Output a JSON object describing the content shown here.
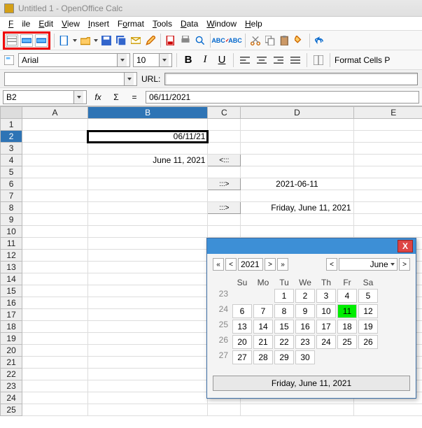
{
  "title": "Untitled 1 - OpenOffice Calc",
  "menu": {
    "file": "File",
    "edit": "Edit",
    "view": "View",
    "insert": "Insert",
    "format": "Format",
    "tools": "Tools",
    "data": "Data",
    "window": "Window",
    "help": "Help"
  },
  "format": {
    "font": "Arial",
    "size": "10",
    "cells": "Format Cells  P"
  },
  "url_label": "URL:",
  "cellref": "B2",
  "formula": "06/11/2021",
  "cols": [
    "A",
    "B",
    "C",
    "D",
    "E"
  ],
  "rows": [
    "1",
    "2",
    "3",
    "4",
    "5",
    "6",
    "7",
    "8",
    "9",
    "10",
    "11",
    "12",
    "13",
    "14",
    "15",
    "16",
    "17",
    "18",
    "19",
    "20",
    "21",
    "22",
    "23",
    "24",
    "25"
  ],
  "cells": {
    "B2": "06/11/21",
    "B4": "June 11, 2021",
    "D6": "2021-06-11",
    "D8": "Friday, June 11, 2021",
    "C4": "<:::",
    "C6": ":::>",
    "C8": ":::>"
  },
  "calendar": {
    "year": "2021",
    "month": "June",
    "nav": {
      "prevfar": "«",
      "prev": "<",
      "next": ">",
      "nextfar": "»"
    },
    "heads": [
      "Su",
      "Mo",
      "Tu",
      "We",
      "Th",
      "Fr",
      "Sa"
    ],
    "weeks": [
      {
        "wk": "23",
        "days": [
          "",
          "",
          "1",
          "2",
          "3",
          "4",
          "5"
        ]
      },
      {
        "wk": "24",
        "days": [
          "6",
          "7",
          "8",
          "9",
          "10",
          "11",
          "12"
        ]
      },
      {
        "wk": "25",
        "days": [
          "13",
          "14",
          "15",
          "16",
          "17",
          "18",
          "19"
        ]
      },
      {
        "wk": "26",
        "days": [
          "20",
          "21",
          "22",
          "23",
          "24",
          "25",
          "26"
        ]
      },
      {
        "wk": "27",
        "days": [
          "27",
          "28",
          "29",
          "30",
          "",
          "",
          ""
        ]
      }
    ],
    "today": "11",
    "status": "Friday, June 11, 2021",
    "close": "X"
  },
  "fmtbtns": {
    "B": "B",
    "I": "I",
    "U": "U"
  },
  "fx": {
    "sigma": "Σ",
    "eq": "=",
    "fx": "f"
  }
}
